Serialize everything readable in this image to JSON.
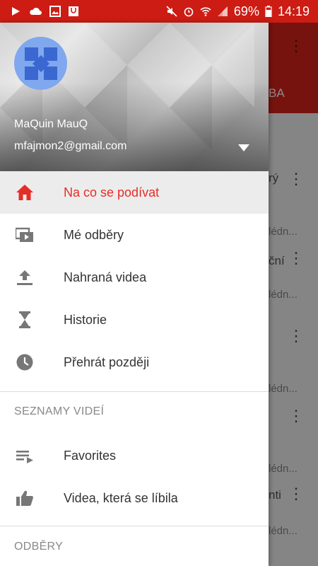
{
  "status_bar": {
    "battery": "69%",
    "time": "14:19",
    "left_icons": [
      "play-icon",
      "cloud-icon",
      "image-icon",
      "shopping-bag-icon"
    ],
    "right_icons": [
      "mute-icon",
      "alarm-icon",
      "wifi-icon",
      "signal-icon",
      "battery-icon"
    ]
  },
  "background": {
    "tab_label": "BA",
    "lines": [
      "rý",
      "lédn...",
      "ční",
      "lédn...",
      "lédn...",
      "lédn...",
      "lédn...",
      "nti",
      "lédn..."
    ]
  },
  "drawer": {
    "account": {
      "name": "MaQuin MauQ",
      "email": "mfajmon2@gmail.com",
      "avatar_color": "#7fa8ee"
    },
    "items": [
      {
        "label": "Na co se podívat",
        "icon": "home-icon",
        "active": true
      },
      {
        "label": "Mé odběry",
        "icon": "subscriptions-icon"
      },
      {
        "label": "Nahraná videa",
        "icon": "upload-icon"
      },
      {
        "label": "Historie",
        "icon": "hourglass-icon"
      },
      {
        "label": "Přehrát později",
        "icon": "clock-icon"
      }
    ],
    "playlists_header": "SEZNAMY VIDEÍ",
    "playlists": [
      {
        "label": "Favorites",
        "icon": "playlist-icon"
      },
      {
        "label": "Videa, která se líbila",
        "icon": "thumbs-up-icon"
      }
    ],
    "subscriptions_header": "ODBĚRY",
    "accent_color": "#e52d27"
  }
}
